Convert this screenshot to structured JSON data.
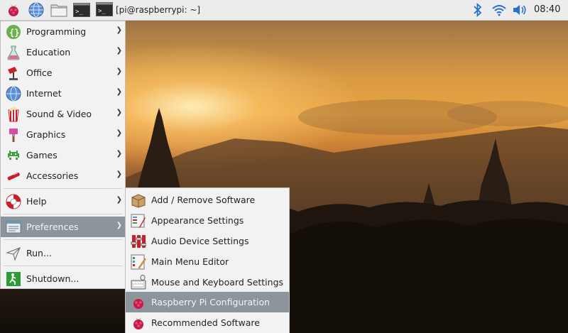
{
  "taskbar": {
    "menu_icon": "raspberry-logo-icon",
    "launchers": [
      "web-browser-icon",
      "file-manager-icon",
      "terminal-icon"
    ],
    "task_title": "[pi@raspberrypi: ~]",
    "tray_icons": [
      "bluetooth-icon",
      "wifi-icon",
      "volume-icon"
    ],
    "clock": "08:40"
  },
  "main_menu": {
    "items": [
      {
        "label": "Programming",
        "icon": "programming-icon"
      },
      {
        "label": "Education",
        "icon": "education-icon"
      },
      {
        "label": "Office",
        "icon": "office-icon"
      },
      {
        "label": "Internet",
        "icon": "internet-icon"
      },
      {
        "label": "Sound & Video",
        "icon": "sound-video-icon"
      },
      {
        "label": "Graphics",
        "icon": "graphics-icon"
      },
      {
        "label": "Games",
        "icon": "games-icon"
      },
      {
        "label": "Accessories",
        "icon": "accessories-icon"
      },
      {
        "label": "Help",
        "icon": "help-icon"
      },
      {
        "label": "Preferences",
        "icon": "preferences-icon"
      },
      {
        "label": "Run...",
        "icon": "run-icon"
      },
      {
        "label": "Shutdown...",
        "icon": "shutdown-icon"
      }
    ],
    "active_item": "Preferences"
  },
  "preferences_menu": {
    "items": [
      {
        "label": "Add / Remove Software",
        "icon": "package-icon"
      },
      {
        "label": "Appearance Settings",
        "icon": "appearance-icon"
      },
      {
        "label": "Audio Device Settings",
        "icon": "audio-settings-icon"
      },
      {
        "label": "Main Menu Editor",
        "icon": "menu-editor-icon"
      },
      {
        "label": "Mouse and Keyboard Settings",
        "icon": "mouse-keyboard-icon"
      },
      {
        "label": "Raspberry Pi Configuration",
        "icon": "raspberry-config-icon"
      },
      {
        "label": "Recommended Software",
        "icon": "recommended-software-icon"
      }
    ],
    "highlighted_item": "Raspberry Pi Configuration"
  },
  "colors": {
    "menu_bg": "#f2f2f2",
    "highlight": "#8d959c",
    "taskbar_bg": "#ececec",
    "raspberry": "#c51a4a"
  }
}
